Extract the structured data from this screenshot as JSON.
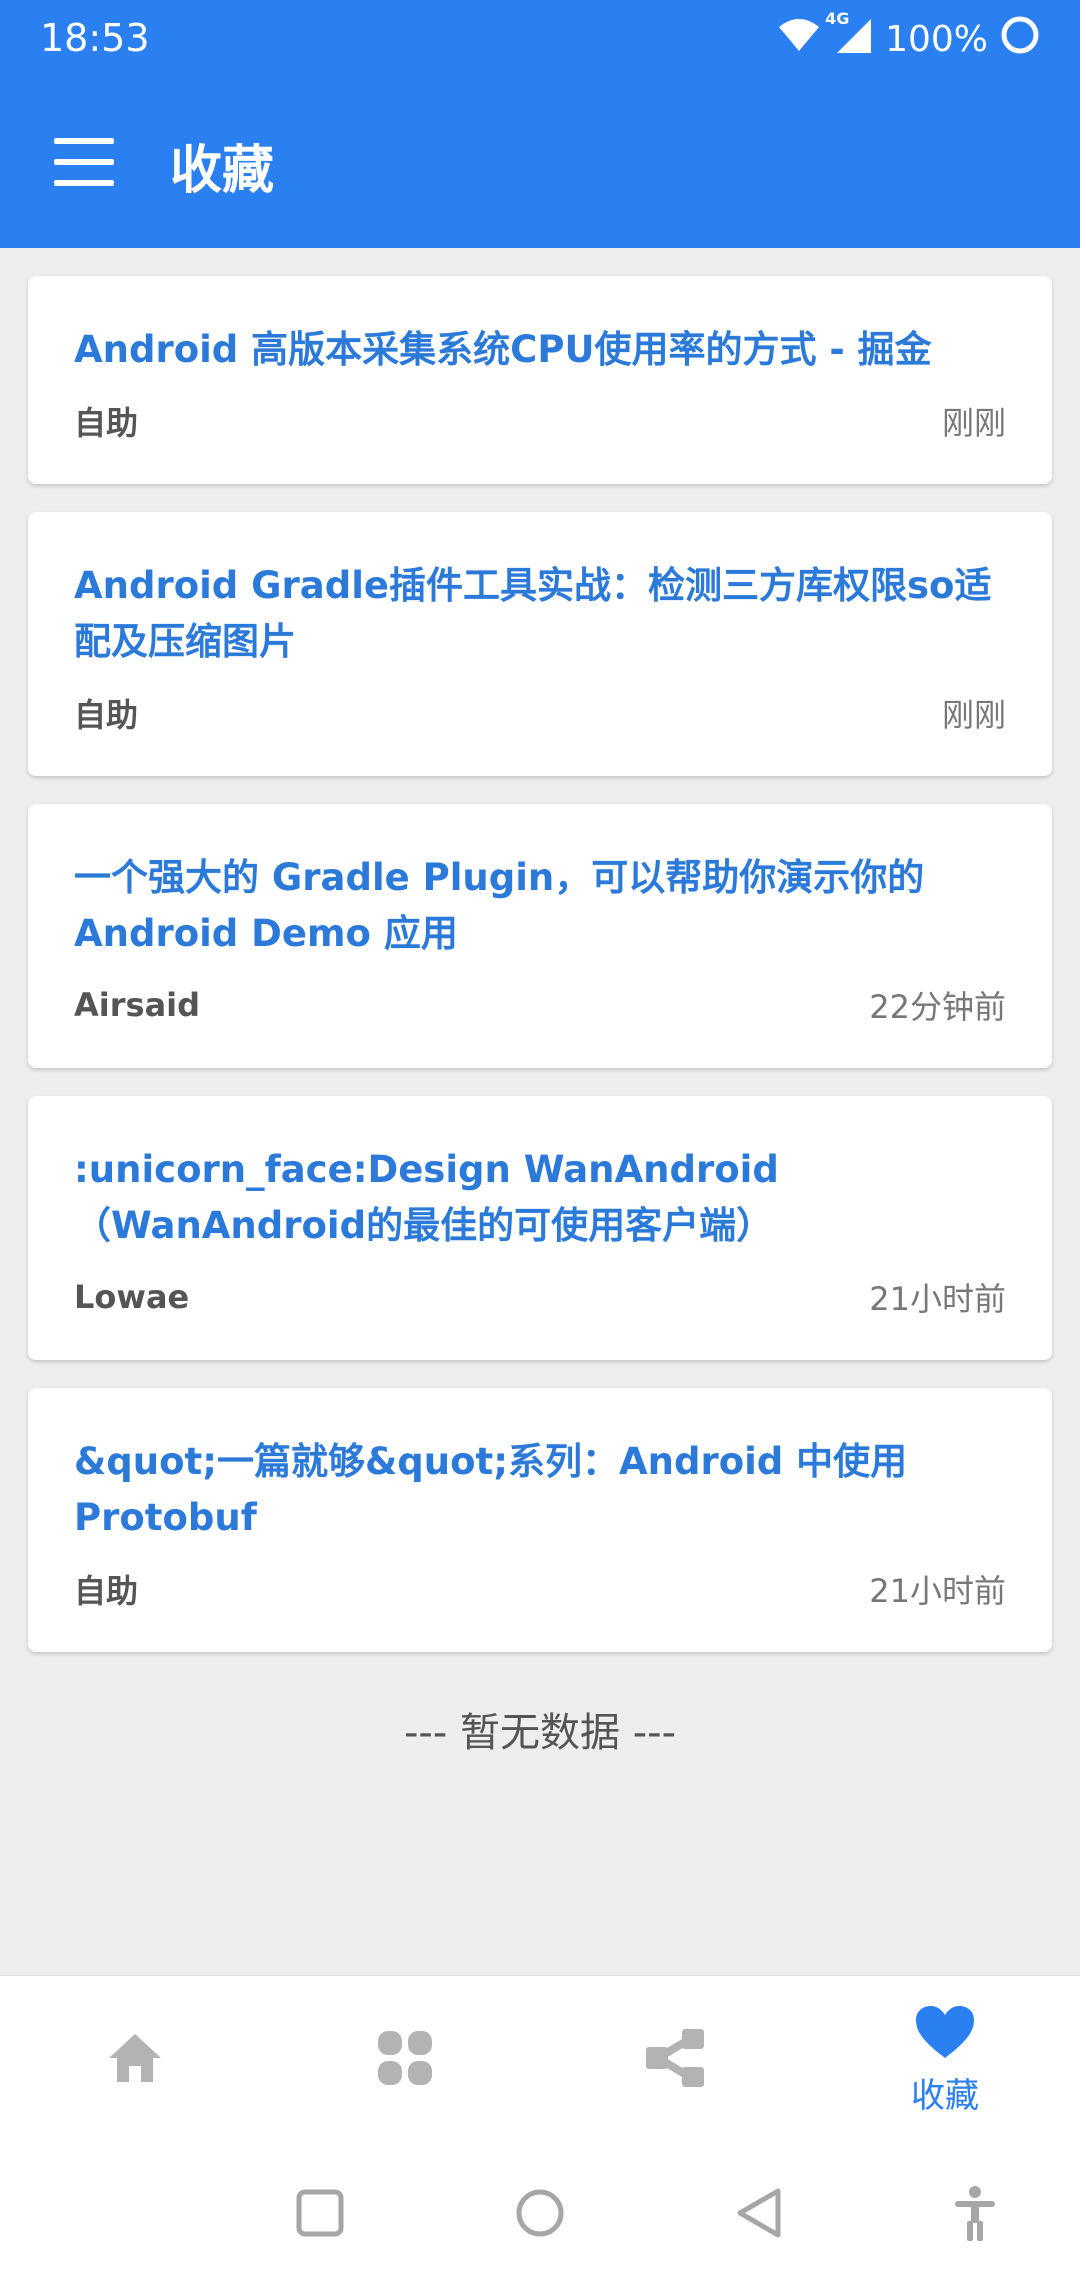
{
  "status_bar": {
    "time": "18:53",
    "network": "4G",
    "battery": "100%"
  },
  "app_bar": {
    "title": "收藏"
  },
  "articles": [
    {
      "title": "Android 高版本采集系统CPU使用率的方式 - 掘金",
      "author": "自助",
      "time": "刚刚"
    },
    {
      "title": "Android Gradle插件工具实战：检测三方库权限so适配及压缩图片",
      "author": "自助",
      "time": "刚刚"
    },
    {
      "title": "一个强大的 Gradle Plugin，可以帮助你演示你的 Android Demo 应用",
      "author": "Airsaid",
      "time": "22分钟前"
    },
    {
      "title": ":unicorn_face:Design WanAndroid（WanAndroid的最佳的可使用客户端）",
      "author": "Lowae",
      "time": "21小时前"
    },
    {
      "title": "&quot;一篇就够&quot;系列：Android 中使用 Protobuf",
      "author": "自助",
      "time": "21小时前"
    }
  ],
  "empty_text": "--- 暂无数据 ---",
  "bottom_nav": {
    "active_label": "收藏",
    "items": [
      {
        "icon": "home-icon"
      },
      {
        "icon": "grid-icon"
      },
      {
        "icon": "share-icon"
      },
      {
        "icon": "heart-icon",
        "label": "收藏"
      }
    ]
  },
  "colors": {
    "primary": "#2a7ff1",
    "title_blue": "#2b7ad9",
    "background": "#eeeeee",
    "inactive_icon": "#b3b3b3"
  }
}
